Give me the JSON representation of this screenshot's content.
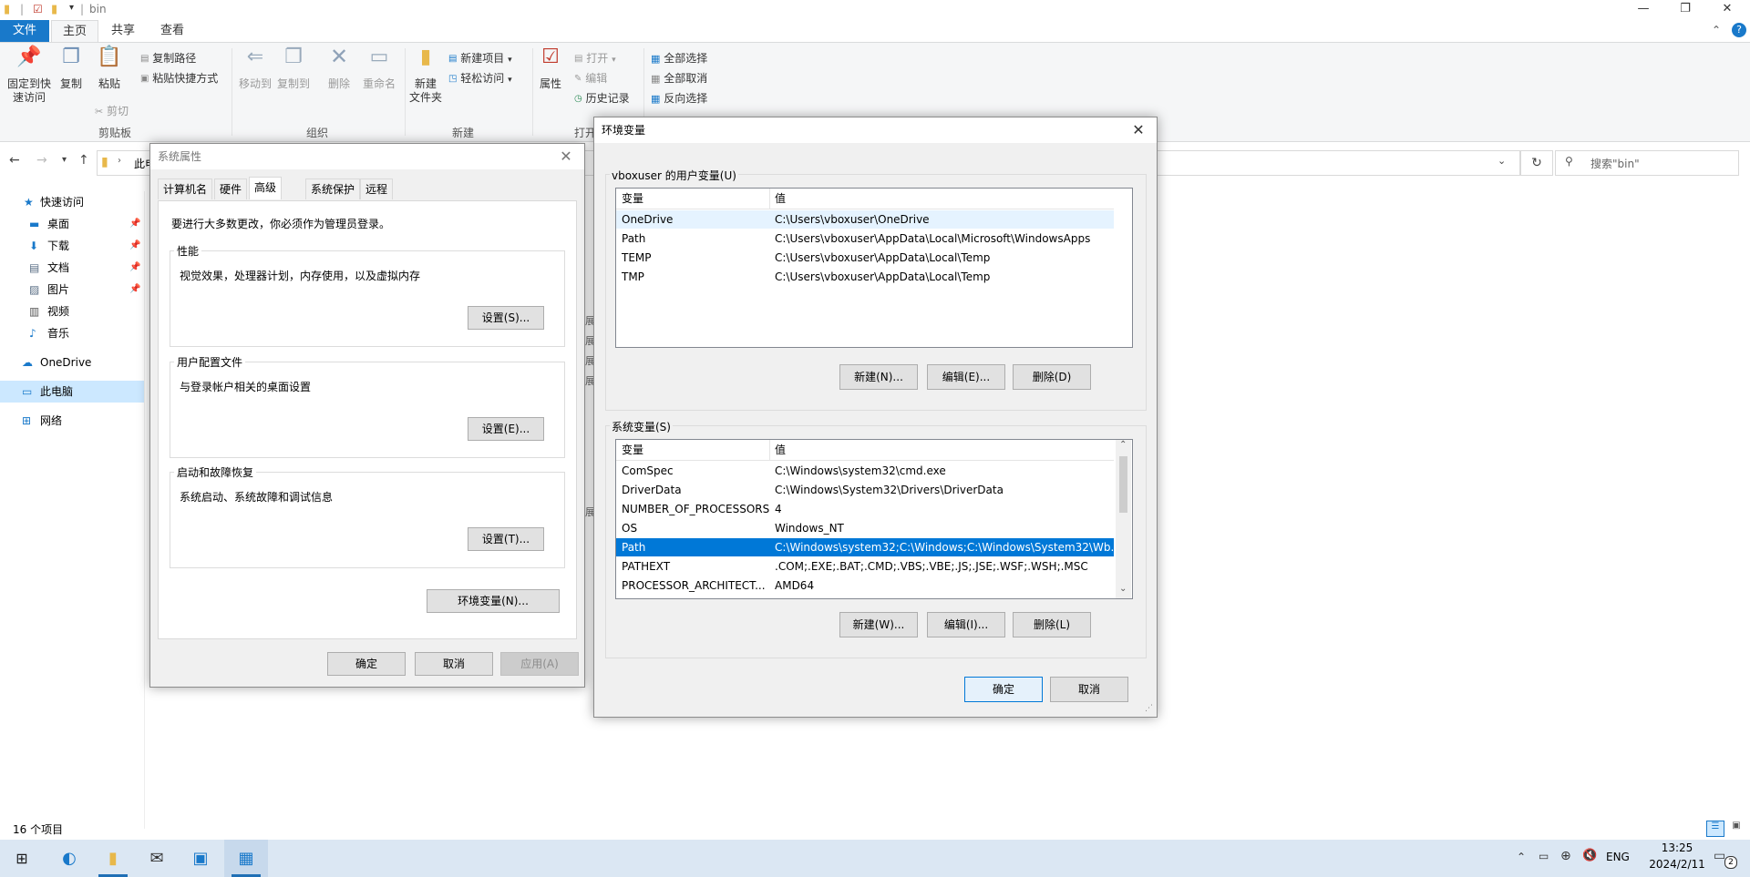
{
  "window": {
    "title": "bin"
  },
  "ribbon": {
    "tabs": [
      "文件",
      "主页",
      "共享",
      "查看"
    ],
    "clipboard": {
      "pin": "固定到快\n速访问",
      "copy": "复制",
      "paste": "粘贴",
      "copy_path": "复制路径",
      "paste_shortcut": "粘贴快捷方式",
      "cut": "剪切",
      "label": "剪贴板"
    },
    "organize": {
      "move_to": "移动到",
      "copy_to": "复制到",
      "delete": "删除",
      "rename": "重命名",
      "label": "组织"
    },
    "new": {
      "new_folder": "新建\n文件夹",
      "new_item": "新建项目",
      "easy_access": "轻松访问",
      "label": "新建"
    },
    "open": {
      "properties": "属性",
      "open": "打开",
      "edit": "编辑",
      "history": "历史记录",
      "label": "打开"
    },
    "select": {
      "select_all": "全部选择",
      "select_none": "全部取消",
      "invert": "反向选择"
    }
  },
  "address": {
    "path": "此电",
    "search_placeholder": "搜索\"bin\""
  },
  "nav": {
    "items": [
      {
        "label": "快速访问",
        "icon": "star-icon"
      },
      {
        "label": "桌面",
        "icon": "desktop-icon",
        "pinned": true
      },
      {
        "label": "下载",
        "icon": "download-icon",
        "pinned": true
      },
      {
        "label": "文档",
        "icon": "document-icon",
        "pinned": true
      },
      {
        "label": "图片",
        "icon": "picture-icon",
        "pinned": true
      },
      {
        "label": "视频",
        "icon": "video-icon"
      },
      {
        "label": "音乐",
        "icon": "music-icon"
      },
      {
        "label": "OneDrive",
        "icon": "cloud-icon"
      },
      {
        "label": "此电脑",
        "icon": "computer-icon",
        "selected": true
      },
      {
        "label": "网络",
        "icon": "network-icon"
      }
    ]
  },
  "status": {
    "count": "16 个项目"
  },
  "sysprops": {
    "title": "系统属性",
    "tabs": [
      "计算机名",
      "硬件",
      "高级",
      "系统保护",
      "远程"
    ],
    "admin_note": "要进行大多数更改，你必须作为管理员登录。",
    "perf": {
      "label": "性能",
      "desc": "视觉效果，处理器计划，内存使用，以及虚拟内存",
      "btn": "设置(S)..."
    },
    "profile": {
      "label": "用户配置文件",
      "desc": "与登录帐户相关的桌面设置",
      "btn": "设置(E)..."
    },
    "startup": {
      "label": "启动和故障恢复",
      "desc": "系统启动、系统故障和调试信息",
      "btn": "设置(T)..."
    },
    "env_btn": "环境变量(N)...",
    "ok": "确定",
    "cancel": "取消",
    "apply": "应用(A)"
  },
  "envvars": {
    "title": "环境变量",
    "user_label": "vboxuser 的用户变量(U)",
    "col_var": "变量",
    "col_val": "值",
    "user_vars": [
      {
        "name": "OneDrive",
        "value": "C:\\Users\\vboxuser\\OneDrive"
      },
      {
        "name": "Path",
        "value": "C:\\Users\\vboxuser\\AppData\\Local\\Microsoft\\WindowsApps"
      },
      {
        "name": "TEMP",
        "value": "C:\\Users\\vboxuser\\AppData\\Local\\Temp"
      },
      {
        "name": "TMP",
        "value": "C:\\Users\\vboxuser\\AppData\\Local\\Temp"
      }
    ],
    "user_btns": {
      "new": "新建(N)...",
      "edit": "编辑(E)...",
      "delete": "删除(D)"
    },
    "sys_label": "系统变量(S)",
    "sys_vars": [
      {
        "name": "ComSpec",
        "value": "C:\\Windows\\system32\\cmd.exe"
      },
      {
        "name": "DriverData",
        "value": "C:\\Windows\\System32\\Drivers\\DriverData"
      },
      {
        "name": "NUMBER_OF_PROCESSORS",
        "value": "4"
      },
      {
        "name": "OS",
        "value": "Windows_NT"
      },
      {
        "name": "Path",
        "value": "C:\\Windows\\system32;C:\\Windows;C:\\Windows\\System32\\Wb..."
      },
      {
        "name": "PATHEXT",
        "value": ".COM;.EXE;.BAT;.CMD;.VBS;.VBE;.JS;.JSE;.WSF;.WSH;.MSC"
      },
      {
        "name": "PROCESSOR_ARCHITECT...",
        "value": "AMD64"
      }
    ],
    "sys_btns": {
      "new": "新建(W)...",
      "edit": "编辑(I)...",
      "delete": "删除(L)"
    },
    "ok": "确定",
    "cancel": "取消"
  },
  "taskbar": {
    "lang": "ENG",
    "time": "13:25",
    "date": "2024/2/11",
    "notif_count": "2"
  },
  "colors": {
    "accent": "#0078d7",
    "file_tab": "#1979ca",
    "taskbar": "#dbe7f3"
  }
}
